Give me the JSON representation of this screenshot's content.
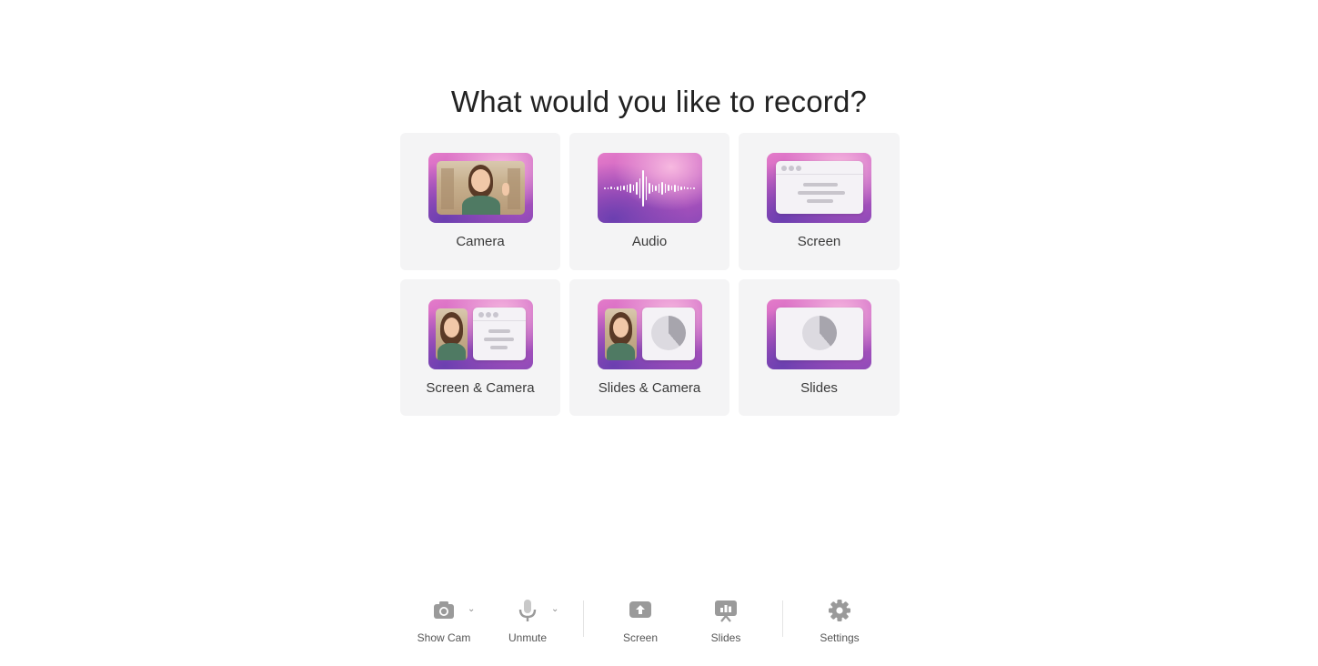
{
  "heading": "What would you like to record?",
  "options": [
    {
      "label": "Camera",
      "icon": "camera-preview-icon"
    },
    {
      "label": "Audio",
      "icon": "audio-waveform-icon"
    },
    {
      "label": "Screen",
      "icon": "screen-window-icon"
    },
    {
      "label": "Screen & Camera",
      "icon": "screen-camera-icon"
    },
    {
      "label": "Slides & Camera",
      "icon": "slides-camera-icon"
    },
    {
      "label": "Slides",
      "icon": "slides-pie-icon"
    }
  ],
  "toolbar": {
    "show_cam": "Show Cam",
    "unmute": "Unmute",
    "screen": "Screen",
    "slides": "Slides",
    "settings": "Settings"
  },
  "colors": {
    "card_bg": "#f4f4f5",
    "thumb_pink": "#e47cc9",
    "thumb_purple": "#8e4ab8",
    "icon_gray": "#9a9a9a"
  }
}
